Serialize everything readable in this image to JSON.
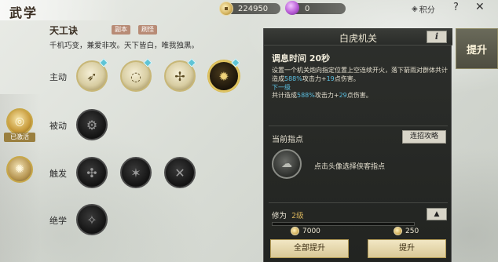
{
  "header": {
    "title": "武学",
    "gold": "224950",
    "gem": "0",
    "points_label": "积分",
    "help": "?",
    "close": "✕"
  },
  "school": {
    "name": "天工诀",
    "tags": [
      "副本",
      "刷怪"
    ],
    "desc": "千机巧变，兼爱非攻。天下皆白，唯我独黑。"
  },
  "categories": {
    "activated": "已激活"
  },
  "rows": {
    "active": "主动",
    "passive": "被动",
    "trigger": "触发",
    "ultimate": "绝学"
  },
  "panel": {
    "title": "白虎机关",
    "info_label": "i",
    "adjust_time": "调息时间 20秒",
    "desc_pre": "设置一个机关炮向指定位置上空连续开火，落下箭雨对群体共计造成",
    "desc_pct1": "588%",
    "desc_mid": "攻击力+",
    "desc_add1": "19",
    "desc_post": "点伤害。",
    "next_label": "下一级",
    "next_pre": "共计造成",
    "next_pct": "588%",
    "next_mid": "攻击力+",
    "next_add": "29",
    "next_post": "点伤害。",
    "guide_label": "当前指点",
    "link_btn": "连招攻略",
    "guide_hint": "点击头像选择侠客指点",
    "cultivate_label": "修为",
    "cultivate_level": "2级",
    "progress": 0.0,
    "cost_gold": "7000",
    "cost_other": "250",
    "all_upgrade": "全部提升",
    "upgrade": "提升"
  },
  "upgrade_tab": "提升"
}
